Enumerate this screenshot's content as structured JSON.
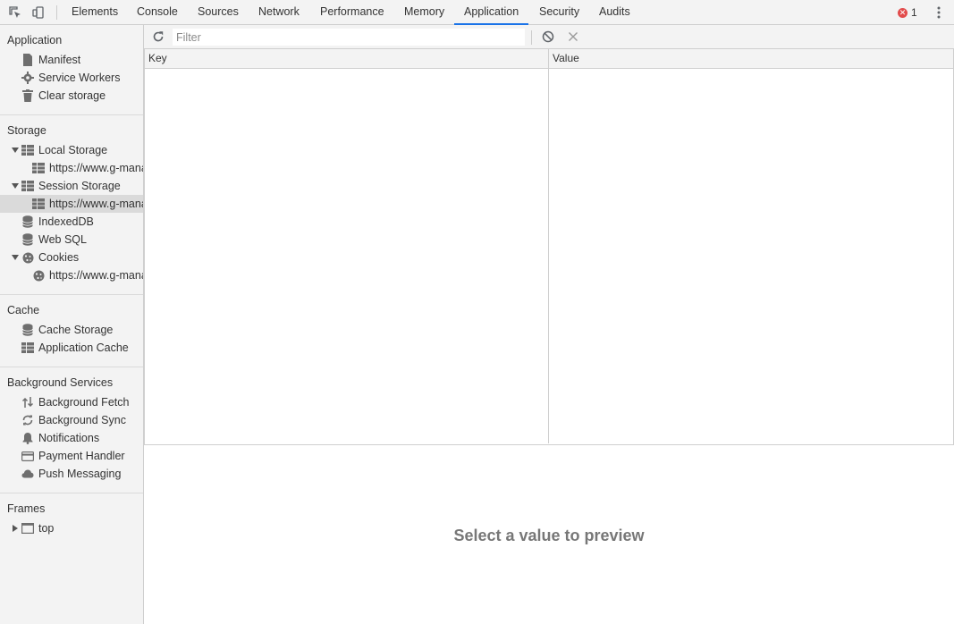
{
  "toolbar": {
    "tabs": [
      {
        "label": "Elements"
      },
      {
        "label": "Console"
      },
      {
        "label": "Sources"
      },
      {
        "label": "Network"
      },
      {
        "label": "Performance"
      },
      {
        "label": "Memory"
      },
      {
        "label": "Application"
      },
      {
        "label": "Security"
      },
      {
        "label": "Audits"
      }
    ],
    "active_tab": "Application",
    "error_count": "1",
    "accent_color": "#1a73e8",
    "error_color": "#e24c4c",
    "icons": [
      "inspect-element-icon",
      "device-toolbar-icon",
      "error-icon",
      "more-options-icon"
    ]
  },
  "sidebar": {
    "sections": {
      "application": {
        "title": "Application",
        "items": [
          {
            "label": "Manifest",
            "icon": "document-icon"
          },
          {
            "label": "Service Workers",
            "icon": "gear-icon"
          },
          {
            "label": "Clear storage",
            "icon": "trash-icon"
          }
        ]
      },
      "storage": {
        "title": "Storage",
        "items": [
          {
            "label": "Local Storage",
            "icon": "grid-icon",
            "expanded": true
          },
          {
            "label": "https://www.g-mana",
            "icon": "grid-icon"
          },
          {
            "label": "Session Storage",
            "icon": "grid-icon",
            "expanded": true
          },
          {
            "label": "https://www.g-mana",
            "icon": "grid-icon",
            "selected": true
          },
          {
            "label": "IndexedDB",
            "icon": "database-icon"
          },
          {
            "label": "Web SQL",
            "icon": "database-icon"
          },
          {
            "label": "Cookies",
            "icon": "cookie-icon",
            "expanded": true
          },
          {
            "label": "https://www.g-mana",
            "icon": "cookie-icon"
          }
        ]
      },
      "cache": {
        "title": "Cache",
        "items": [
          {
            "label": "Cache Storage",
            "icon": "database-icon"
          },
          {
            "label": "Application Cache",
            "icon": "grid-icon"
          }
        ]
      },
      "background_services": {
        "title": "Background Services",
        "items": [
          {
            "label": "Background Fetch",
            "icon": "up-down-arrows-icon"
          },
          {
            "label": "Background Sync",
            "icon": "sync-icon"
          },
          {
            "label": "Notifications",
            "icon": "bell-icon"
          },
          {
            "label": "Payment Handler",
            "icon": "credit-card-icon"
          },
          {
            "label": "Push Messaging",
            "icon": "cloud-icon"
          }
        ]
      },
      "frames": {
        "title": "Frames",
        "items": [
          {
            "label": "top",
            "icon": "frame-icon",
            "expanded": false
          }
        ]
      }
    }
  },
  "main": {
    "filter": {
      "placeholder": "Filter",
      "value": ""
    },
    "columns": {
      "key": "Key",
      "value": "Value"
    },
    "rows": [],
    "preview_text": "Select a value to preview"
  }
}
